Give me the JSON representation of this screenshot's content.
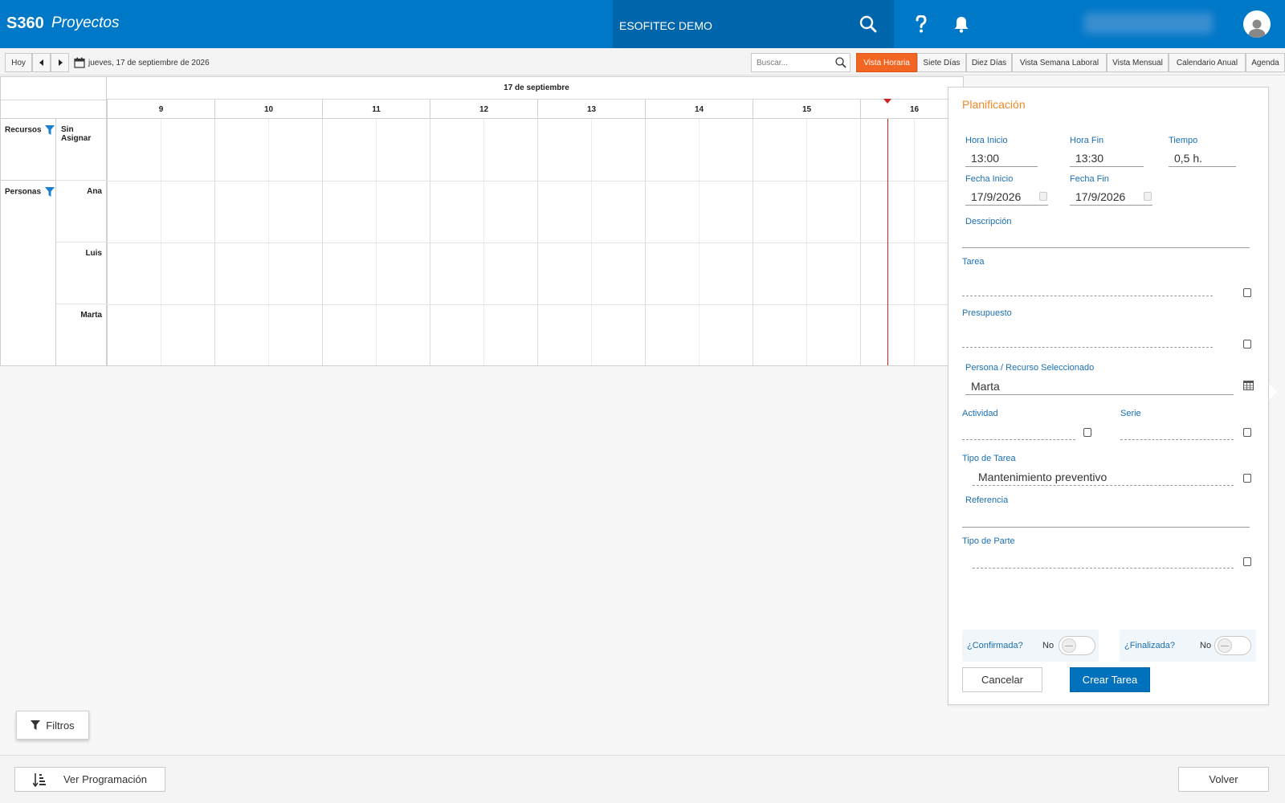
{
  "header": {
    "brand": "S360",
    "module": "Proyectos",
    "company": "ESOFITEC DEMO",
    "icons": [
      "search-icon",
      "help-icon",
      "bell-icon",
      "user-icon"
    ]
  },
  "toolbar": {
    "today_label": "Hoy",
    "date_label": "jueves, 17 de septiembre de 2026",
    "search_placeholder": "Buscar...",
    "views": [
      "Vista Horaria",
      "Siete Días",
      "Diez Días",
      "Vista Semana Laboral",
      "Vista Mensual",
      "Calendario Anual",
      "Agenda"
    ],
    "active_view": "Vista Horaria"
  },
  "scheduler": {
    "date": "17 de septiembre",
    "hours": [
      "9",
      "10",
      "11",
      "12",
      "13",
      "14",
      "15",
      "16"
    ],
    "groups": [
      {
        "name": "Recursos",
        "resources": [
          "Sin Asignar"
        ]
      },
      {
        "name": "Personas",
        "resources": [
          "Ana",
          "Luis",
          "Marta"
        ]
      }
    ]
  },
  "panel": {
    "title": "Planificación",
    "hora_inicio_label": "Hora Inicio",
    "hora_inicio": "13:00",
    "hora_fin_label": "Hora Fin",
    "hora_fin": "13:30",
    "tiempo_label": "Tiempo",
    "tiempo": "0,5 h.",
    "fecha_inicio_label": "Fecha Inicio",
    "fecha_inicio": "17/9/2026",
    "fecha_fin_label": "Fecha Fin",
    "fecha_fin": "17/9/2026",
    "descripcion_label": "Descripción",
    "descripcion": "",
    "tarea_label": "Tarea",
    "tarea": "",
    "presupuesto_label": "Presupuesto",
    "presupuesto": "",
    "persona_label": "Persona / Recurso Seleccionado",
    "persona": "Marta",
    "actividad_label": "Actividad",
    "actividad": "",
    "serie_label": "Serie",
    "serie": "",
    "tipo_tarea_label": "Tipo de Tarea",
    "tipo_tarea": "Mantenimiento preventivo",
    "referencia_label": "Referencia",
    "referencia": "",
    "tipo_parte_label": "Tipo de Parte",
    "tipo_parte": "",
    "confirmada_label": "¿Confirmada?",
    "confirmada_value": "No",
    "finalizada_label": "¿Finalizada?",
    "finalizada_value": "No",
    "cancel_label": "Cancelar",
    "create_label": "Crear Tarea"
  },
  "bottom": {
    "filtros_label": "Filtros",
    "ver_programacion_label": "Ver Programación",
    "volver_label": "Volver"
  },
  "colors": {
    "brand_blue": "#0078c8",
    "active_tab": "#f26522",
    "now_line": "#d42020",
    "panel_title": "#f08a24"
  }
}
